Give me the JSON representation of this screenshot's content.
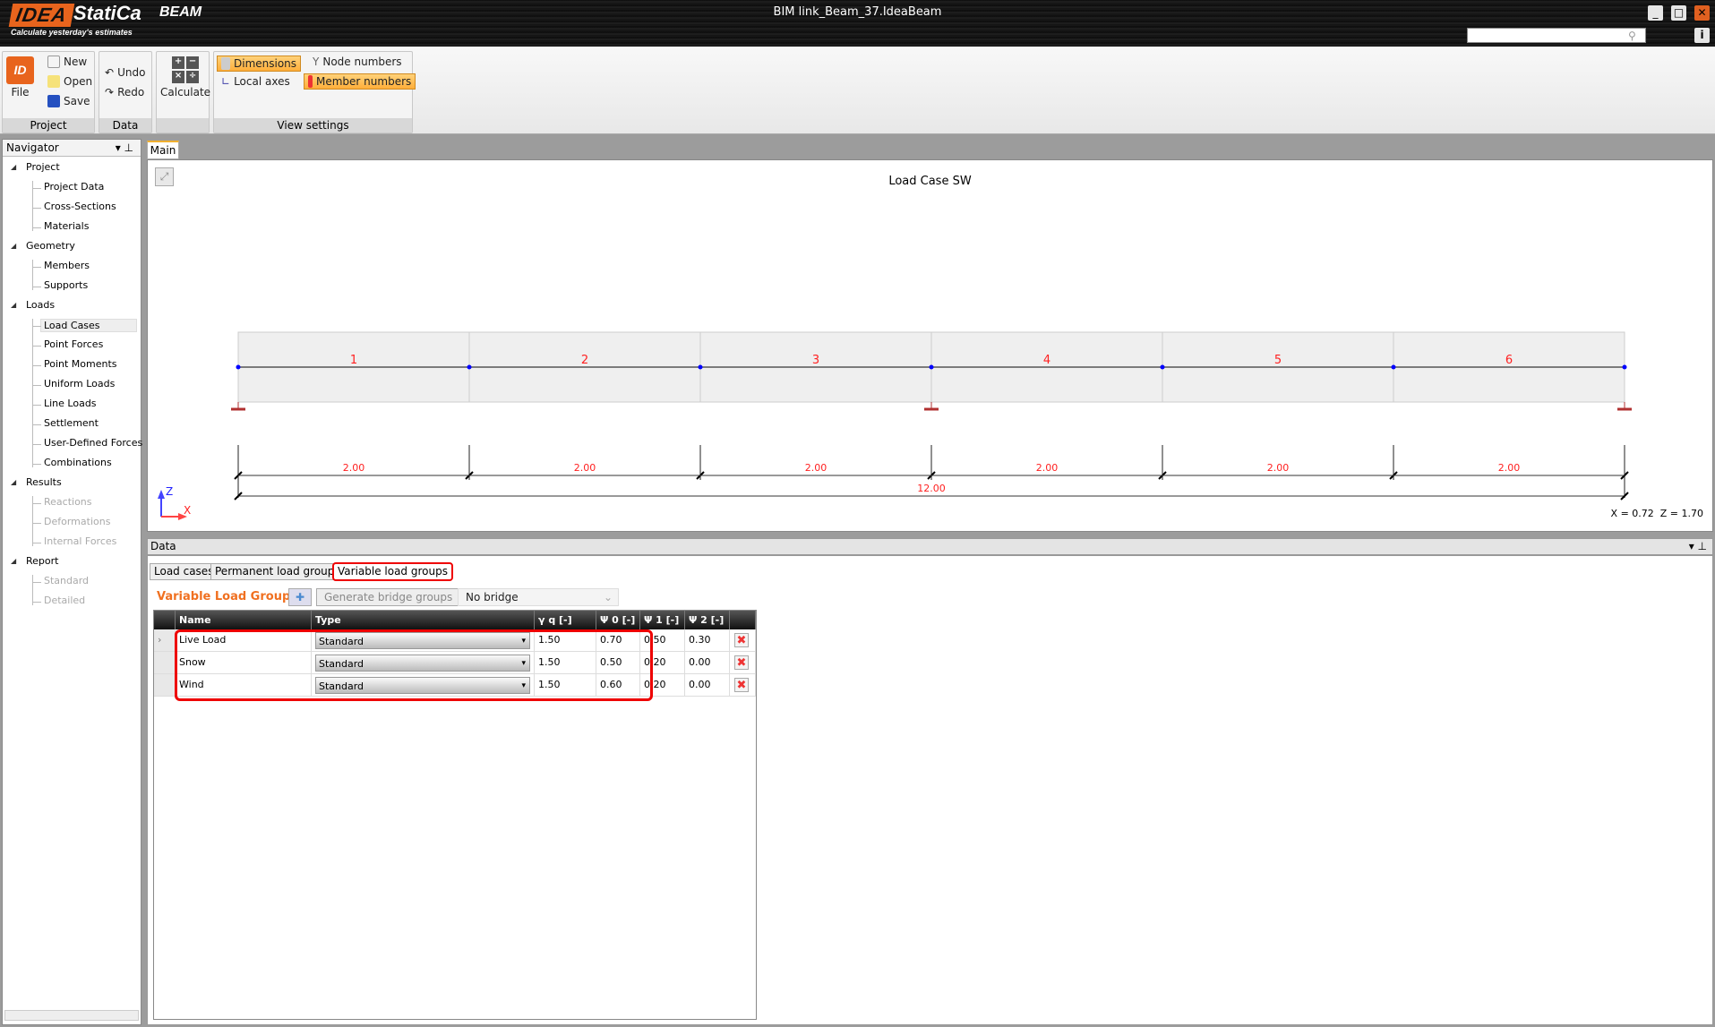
{
  "app": {
    "logo_mark": "IDEA",
    "logo_name": "StatiCa",
    "product": "BEAM",
    "slogan": "Calculate yesterday's estimates",
    "window_title": "BIM link_Beam_37.IdeaBeam",
    "search_placeholder": ""
  },
  "ribbon": {
    "project": {
      "label": "Project",
      "file": "File",
      "new": "New",
      "open": "Open",
      "save": "Save"
    },
    "data": {
      "label": "Data",
      "undo": "Undo",
      "redo": "Redo"
    },
    "calc": {
      "calculate": "Calculate"
    },
    "view": {
      "label": "View settings",
      "dimensions": "Dimensions",
      "local_axes": "Local axes",
      "node_numbers": "Node numbers",
      "member_numbers": "Member numbers",
      "dimensions_active": true,
      "member_numbers_active": true
    }
  },
  "navigator": {
    "title": "Navigator",
    "groups": [
      {
        "label": "Project",
        "items": [
          {
            "label": "Project Data"
          },
          {
            "label": "Cross-Sections"
          },
          {
            "label": "Materials"
          }
        ]
      },
      {
        "label": "Geometry",
        "items": [
          {
            "label": "Members"
          },
          {
            "label": "Supports"
          }
        ]
      },
      {
        "label": "Loads",
        "items": [
          {
            "label": "Load Cases",
            "selected": true
          },
          {
            "label": "Point Forces"
          },
          {
            "label": "Point Moments"
          },
          {
            "label": "Uniform Loads"
          },
          {
            "label": "Line Loads"
          },
          {
            "label": "Settlement"
          },
          {
            "label": "User-Defined Forces"
          },
          {
            "label": "Combinations"
          }
        ]
      },
      {
        "label": "Results",
        "items": [
          {
            "label": "Reactions",
            "disabled": true
          },
          {
            "label": "Deformations",
            "disabled": true
          },
          {
            "label": "Internal Forces",
            "disabled": true
          }
        ]
      },
      {
        "label": "Report",
        "items": [
          {
            "label": "Standard",
            "disabled": true
          },
          {
            "label": "Detailed",
            "disabled": true
          }
        ]
      }
    ]
  },
  "main": {
    "tab": "Main",
    "canvas_title": "Load Case SW",
    "coords": "X = 0.72  Z = 1.70",
    "axis_z": "Z",
    "axis_x": "X",
    "members": [
      "1",
      "2",
      "3",
      "4",
      "5",
      "6"
    ],
    "spans": [
      "2.00",
      "2.00",
      "2.00",
      "2.00",
      "2.00",
      "2.00"
    ],
    "total": "12.00",
    "support_nodes": [
      0,
      3,
      6
    ],
    "colors": {
      "member_number": "#ff2020",
      "node": "#0000ff",
      "support": "#b03030"
    }
  },
  "data_panel": {
    "title": "Data",
    "tabs": [
      "Load cases",
      "Permanent load groups",
      "Variable load groups"
    ],
    "active_tab": 2,
    "heading": "Variable Load Groups",
    "generate_btn": "Generate bridge groups",
    "bridge_select": "No bridge",
    "columns": [
      "Name",
      "Type",
      "γ q [-]",
      "Ψ 0 [-]",
      "Ψ 1 [-]",
      "Ψ 2 [-]"
    ],
    "rows": [
      {
        "name": "Live Load",
        "type": "Standard",
        "gq": "1.50",
        "p0": "0.70",
        "p1": "0.50",
        "p2": "0.30"
      },
      {
        "name": "Snow",
        "type": "Standard",
        "gq": "1.50",
        "p0": "0.50",
        "p1": "0.20",
        "p2": "0.00"
      },
      {
        "name": "Wind",
        "type": "Standard",
        "gq": "1.50",
        "p0": "0.60",
        "p1": "0.20",
        "p2": "0.00"
      }
    ]
  }
}
